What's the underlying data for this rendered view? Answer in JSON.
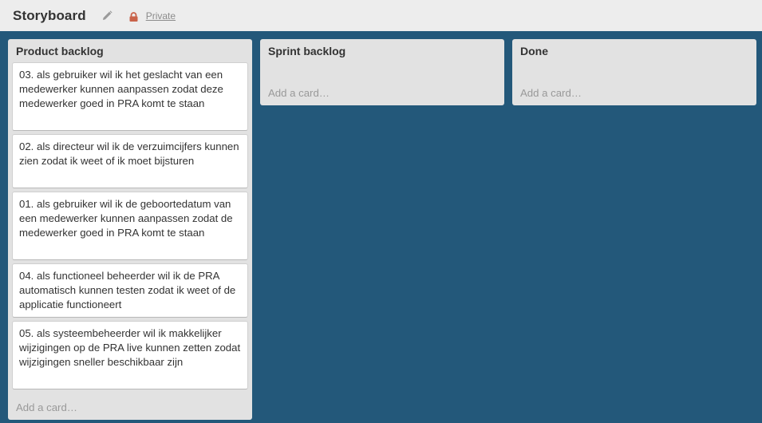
{
  "header": {
    "title": "Storyboard",
    "privacy_label": "Private"
  },
  "lists": [
    {
      "title": "Product backlog",
      "cards": [
        "03. als gebruiker wil ik het geslacht van een medewerker kunnen aanpassen zodat deze medewerker goed in PRA komt te staan",
        "02. als directeur wil ik de verzuimcijfers kunnen zien zodat ik weet of ik moet bijsturen",
        "01. als gebruiker wil ik de geboortedatum van een medewerker kunnen aanpassen zodat de medewerker goed in PRA komt te staan",
        "04. als functioneel beheerder wil ik de PRA automatisch kunnen testen zodat ik weet of de applicatie functioneert",
        "05. als systeembeheerder wil ik makkelijker wijzigingen op de PRA live kunnen zetten zodat wijzigingen sneller beschikbaar zijn"
      ],
      "add_card": "Add a card…"
    },
    {
      "title": "Sprint backlog",
      "cards": [],
      "add_card": "Add a card…"
    },
    {
      "title": "Done",
      "cards": [],
      "add_card": "Add a card…"
    }
  ],
  "colors": {
    "board_background": "#23587a",
    "header_background": "#ededed",
    "list_background": "#e2e2e2",
    "lock_icon": "#c9634a"
  },
  "icons": [
    "pencil-icon",
    "lock-icon"
  ]
}
